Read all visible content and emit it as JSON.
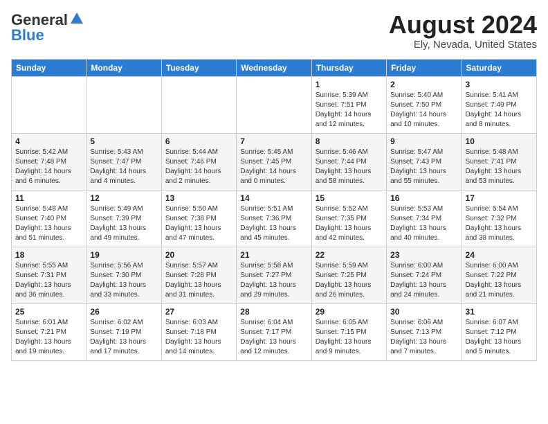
{
  "header": {
    "logo_general": "General",
    "logo_blue": "Blue",
    "month_title": "August 2024",
    "location": "Ely, Nevada, United States"
  },
  "weekdays": [
    "Sunday",
    "Monday",
    "Tuesday",
    "Wednesday",
    "Thursday",
    "Friday",
    "Saturday"
  ],
  "weeks": [
    {
      "days": [
        {
          "num": "",
          "info": ""
        },
        {
          "num": "",
          "info": ""
        },
        {
          "num": "",
          "info": ""
        },
        {
          "num": "",
          "info": ""
        },
        {
          "num": "1",
          "sunrise": "5:39 AM",
          "sunset": "7:51 PM",
          "daylight": "14 hours and 12 minutes."
        },
        {
          "num": "2",
          "sunrise": "5:40 AM",
          "sunset": "7:50 PM",
          "daylight": "14 hours and 10 minutes."
        },
        {
          "num": "3",
          "sunrise": "5:41 AM",
          "sunset": "7:49 PM",
          "daylight": "14 hours and 8 minutes."
        }
      ]
    },
    {
      "days": [
        {
          "num": "4",
          "sunrise": "5:42 AM",
          "sunset": "7:48 PM",
          "daylight": "14 hours and 6 minutes."
        },
        {
          "num": "5",
          "sunrise": "5:43 AM",
          "sunset": "7:47 PM",
          "daylight": "14 hours and 4 minutes."
        },
        {
          "num": "6",
          "sunrise": "5:44 AM",
          "sunset": "7:46 PM",
          "daylight": "14 hours and 2 minutes."
        },
        {
          "num": "7",
          "sunrise": "5:45 AM",
          "sunset": "7:45 PM",
          "daylight": "14 hours and 0 minutes."
        },
        {
          "num": "8",
          "sunrise": "5:46 AM",
          "sunset": "7:44 PM",
          "daylight": "13 hours and 58 minutes."
        },
        {
          "num": "9",
          "sunrise": "5:47 AM",
          "sunset": "7:43 PM",
          "daylight": "13 hours and 55 minutes."
        },
        {
          "num": "10",
          "sunrise": "5:48 AM",
          "sunset": "7:41 PM",
          "daylight": "13 hours and 53 minutes."
        }
      ]
    },
    {
      "days": [
        {
          "num": "11",
          "sunrise": "5:48 AM",
          "sunset": "7:40 PM",
          "daylight": "13 hours and 51 minutes."
        },
        {
          "num": "12",
          "sunrise": "5:49 AM",
          "sunset": "7:39 PM",
          "daylight": "13 hours and 49 minutes."
        },
        {
          "num": "13",
          "sunrise": "5:50 AM",
          "sunset": "7:38 PM",
          "daylight": "13 hours and 47 minutes."
        },
        {
          "num": "14",
          "sunrise": "5:51 AM",
          "sunset": "7:36 PM",
          "daylight": "13 hours and 45 minutes."
        },
        {
          "num": "15",
          "sunrise": "5:52 AM",
          "sunset": "7:35 PM",
          "daylight": "13 hours and 42 minutes."
        },
        {
          "num": "16",
          "sunrise": "5:53 AM",
          "sunset": "7:34 PM",
          "daylight": "13 hours and 40 minutes."
        },
        {
          "num": "17",
          "sunrise": "5:54 AM",
          "sunset": "7:32 PM",
          "daylight": "13 hours and 38 minutes."
        }
      ]
    },
    {
      "days": [
        {
          "num": "18",
          "sunrise": "5:55 AM",
          "sunset": "7:31 PM",
          "daylight": "13 hours and 36 minutes."
        },
        {
          "num": "19",
          "sunrise": "5:56 AM",
          "sunset": "7:30 PM",
          "daylight": "13 hours and 33 minutes."
        },
        {
          "num": "20",
          "sunrise": "5:57 AM",
          "sunset": "7:28 PM",
          "daylight": "13 hours and 31 minutes."
        },
        {
          "num": "21",
          "sunrise": "5:58 AM",
          "sunset": "7:27 PM",
          "daylight": "13 hours and 29 minutes."
        },
        {
          "num": "22",
          "sunrise": "5:59 AM",
          "sunset": "7:25 PM",
          "daylight": "13 hours and 26 minutes."
        },
        {
          "num": "23",
          "sunrise": "6:00 AM",
          "sunset": "7:24 PM",
          "daylight": "13 hours and 24 minutes."
        },
        {
          "num": "24",
          "sunrise": "6:00 AM",
          "sunset": "7:22 PM",
          "daylight": "13 hours and 21 minutes."
        }
      ]
    },
    {
      "days": [
        {
          "num": "25",
          "sunrise": "6:01 AM",
          "sunset": "7:21 PM",
          "daylight": "13 hours and 19 minutes."
        },
        {
          "num": "26",
          "sunrise": "6:02 AM",
          "sunset": "7:19 PM",
          "daylight": "13 hours and 17 minutes."
        },
        {
          "num": "27",
          "sunrise": "6:03 AM",
          "sunset": "7:18 PM",
          "daylight": "13 hours and 14 minutes."
        },
        {
          "num": "28",
          "sunrise": "6:04 AM",
          "sunset": "7:17 PM",
          "daylight": "13 hours and 12 minutes."
        },
        {
          "num": "29",
          "sunrise": "6:05 AM",
          "sunset": "7:15 PM",
          "daylight": "13 hours and 9 minutes."
        },
        {
          "num": "30",
          "sunrise": "6:06 AM",
          "sunset": "7:13 PM",
          "daylight": "13 hours and 7 minutes."
        },
        {
          "num": "31",
          "sunrise": "6:07 AM",
          "sunset": "7:12 PM",
          "daylight": "13 hours and 5 minutes."
        }
      ]
    }
  ],
  "labels": {
    "sunrise": "Sunrise:",
    "sunset": "Sunset:",
    "daylight": "Daylight:"
  }
}
